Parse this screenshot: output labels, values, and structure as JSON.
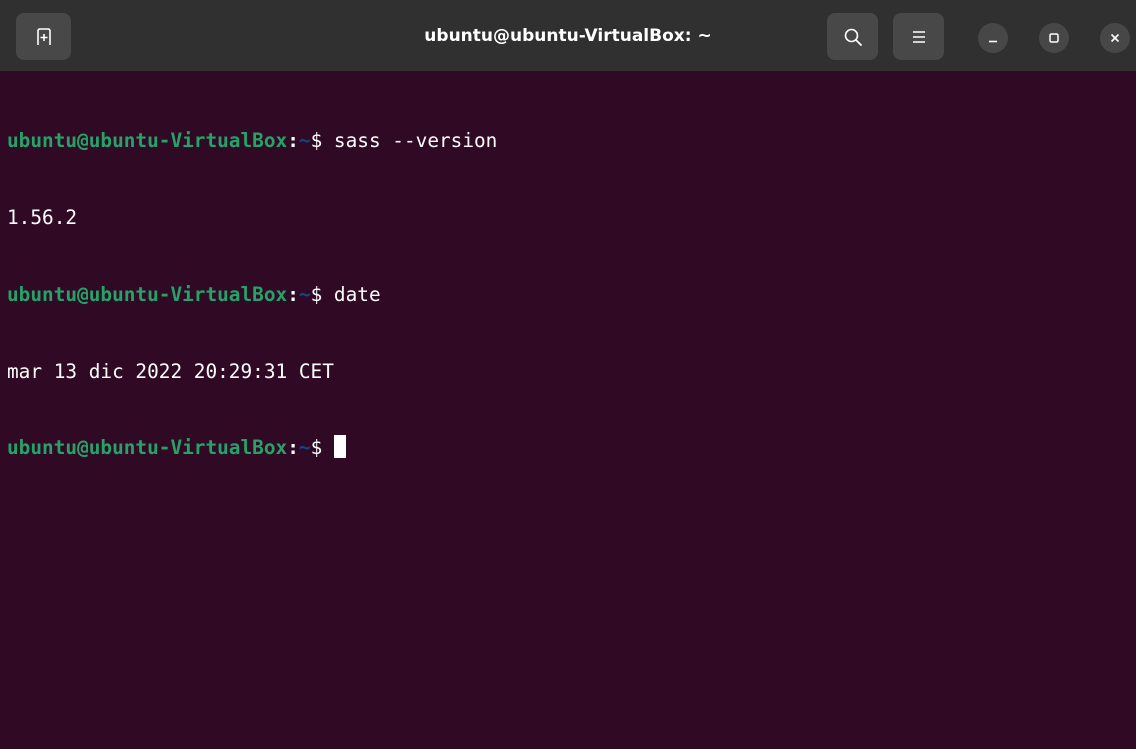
{
  "window": {
    "title": "ubuntu@ubuntu-VirtualBox: ~"
  },
  "titlebar": {
    "icons": {
      "new_tab": "new-tab-icon",
      "search": "search-icon",
      "menu": "hamburger-menu-icon",
      "minimize": "minimize-icon",
      "maximize": "maximize-icon",
      "close": "close-icon"
    }
  },
  "terminal": {
    "colors": {
      "background": "#300a24",
      "user_host": "#26a269",
      "path": "#12488b",
      "text": "#ffffff"
    },
    "lines": [
      {
        "user_host": "ubuntu@ubuntu-VirtualBox",
        "colon": ":",
        "path": "~",
        "symbol": "$ ",
        "command": "sass --version"
      },
      {
        "output": "1.56.2"
      },
      {
        "user_host": "ubuntu@ubuntu-VirtualBox",
        "colon": ":",
        "path": "~",
        "symbol": "$ ",
        "command": "date"
      },
      {
        "output": "mar 13 dic 2022 20:29:31 CET"
      },
      {
        "user_host": "ubuntu@ubuntu-VirtualBox",
        "colon": ":",
        "path": "~",
        "symbol": "$ ",
        "command": ""
      }
    ]
  }
}
